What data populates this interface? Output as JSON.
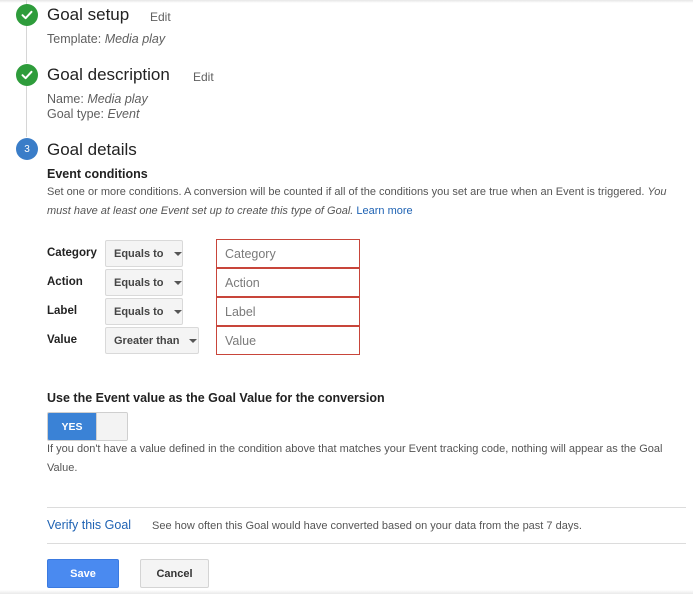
{
  "steps": [
    {
      "status": "done",
      "title": "Goal setup",
      "edit_label": "Edit",
      "details": [
        {
          "label": "Template:",
          "value": "Media play"
        }
      ]
    },
    {
      "status": "done",
      "title": "Goal description",
      "edit_label": "Edit",
      "details": [
        {
          "label": "Name:",
          "value": "Media play"
        },
        {
          "label": "Goal type:",
          "value": "Event"
        }
      ]
    },
    {
      "status": "active",
      "number": "3",
      "title": "Goal details"
    }
  ],
  "event_conditions": {
    "heading": "Event conditions",
    "description": "Set one or more conditions. A conversion will be counted if all of the conditions you set are true when an Event is triggered.",
    "description_italic": "You must have at least one Event set up to create this type of Goal.",
    "learn_more": "Learn more",
    "rows": [
      {
        "label": "Category",
        "operator": "Equals to",
        "placeholder": "Category",
        "value": ""
      },
      {
        "label": "Action",
        "operator": "Equals to",
        "placeholder": "Action",
        "value": ""
      },
      {
        "label": "Label",
        "operator": "Equals to",
        "placeholder": "Label",
        "value": ""
      },
      {
        "label": "Value",
        "operator": "Greater than",
        "placeholder": "Value",
        "value": ""
      }
    ]
  },
  "goal_value": {
    "heading": "Use the Event value as the Goal Value for the conversion",
    "toggle_label": "YES",
    "toggle_state": "on",
    "note": "If you don't have a value defined in the condition above that matches your Event tracking code, nothing will appear as the Goal Value."
  },
  "verify": {
    "link": "Verify this Goal",
    "description": "See how often this Goal would have converted based on your data from the past 7 days."
  },
  "actions": {
    "save_label": "Save",
    "cancel_label": "Cancel"
  },
  "colors": {
    "step_done": "#2e9c3b",
    "step_active": "#3a7dc8",
    "link": "#1e62b3",
    "input_border_error": "#c8453a",
    "primary_button": "#4a8af0"
  }
}
